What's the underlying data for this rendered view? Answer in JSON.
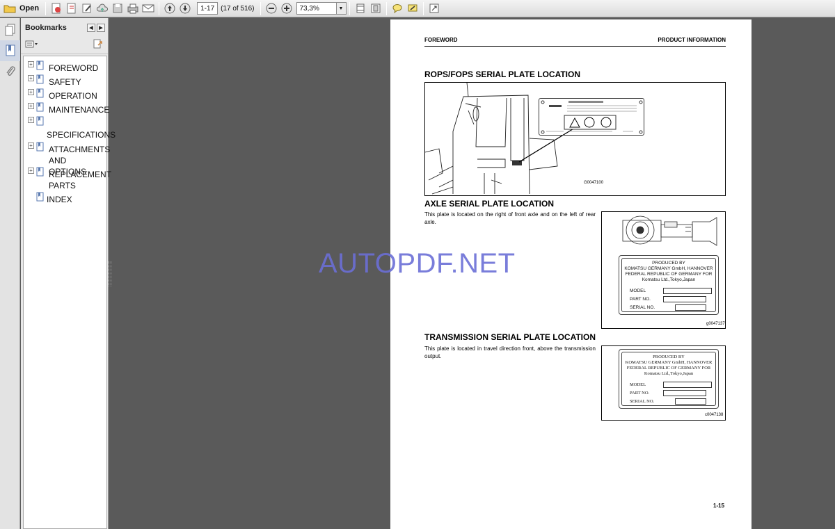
{
  "toolbar": {
    "open_label": "Open",
    "page_current": "1-17",
    "page_of": "(17 of 516)",
    "zoom": "73,3%"
  },
  "bookmarks": {
    "title": "Bookmarks",
    "items": [
      {
        "label": "FOREWORD",
        "expandable": true
      },
      {
        "label": "SAFETY",
        "expandable": true
      },
      {
        "label": "OPERATION",
        "expandable": true
      },
      {
        "label": "MAINTENANCE",
        "expandable": true
      },
      {
        "label": "SPECIFICATIONS",
        "expandable": true
      },
      {
        "label": "ATTACHMENTS AND OPTIONS",
        "expandable": true
      },
      {
        "label": "REPLACEMENT PARTS",
        "expandable": true
      },
      {
        "label": "INDEX",
        "expandable": false
      }
    ]
  },
  "document": {
    "header_left": "FOREWORD",
    "header_right": "PRODUCT INFORMATION",
    "section1_title": "ROPS/FOPS SERIAL PLATE LOCATION",
    "fig1_code": "G0047100",
    "section2_title": "AXLE SERIAL PLATE LOCATION",
    "section2_text": "This plate is located on the right of front axle and on the left of rear axle.",
    "fig2_code": "g0047137",
    "section3_title": "TRANSMISSION SERIAL PLATE LOCATION",
    "section3_text": "This plate is located in travel direction front, above the transmission output.",
    "fig3_code": "c0047138",
    "page_number": "1-15",
    "plate": {
      "line1": "PRODUCED BY",
      "line2": "KOMATSU GERMANY GmbH, HANNOVER",
      "line3": "FEDERAL REPUBLIC OF GERMANY FOR",
      "line4": "Komatsu Ltd.,Tokyo,Japan",
      "model": "MODEL",
      "part_no": "PART NO.",
      "serial_no": "SERIAL NO."
    },
    "plate2": {
      "line1": "PRODUCED BY",
      "line2": "KOMATSU GERMANY GmbH, HANNOVER",
      "line3": "FEDERAL REPUBLIC OF GERMANY FOR",
      "line4": "Komatsu Ltd.,Tokyo,Japan",
      "model": "MODEL",
      "part_no": "PART NO.",
      "serial_no": "SERIAL NO."
    }
  },
  "watermark": "AUTOPDF.NET"
}
